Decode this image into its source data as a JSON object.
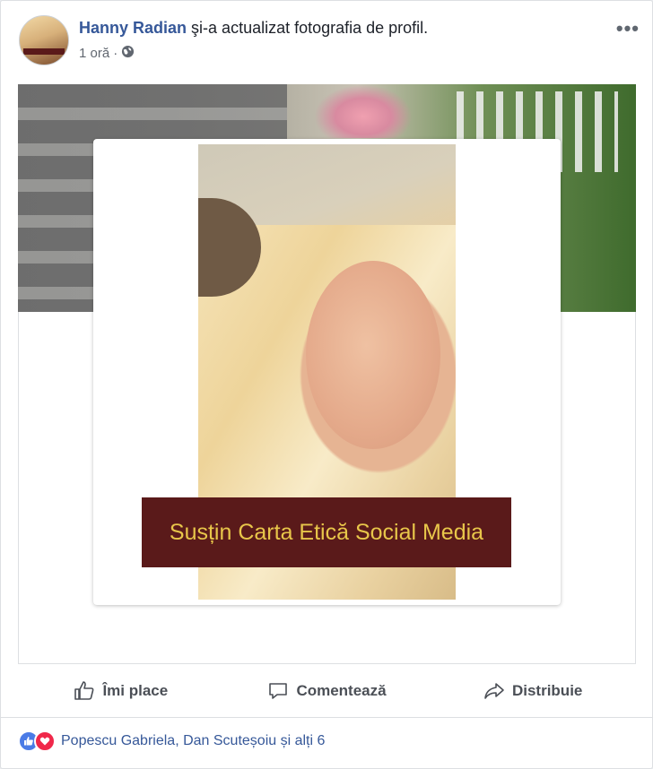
{
  "post": {
    "author": "Hanny Radian",
    "action_text": "şi-a actualizat fotografia de profil.",
    "time": "1 oră",
    "separator": "·",
    "privacy_icon": "globe-icon",
    "more_label": "•••"
  },
  "profile_photo": {
    "banner_text": "Susțin Carta Etică Social Media",
    "banner_colors": {
      "background": "#5a1a1a",
      "text": "#e8c64a"
    }
  },
  "actions": {
    "like_label": "Îmi place",
    "comment_label": "Comentează",
    "share_label": "Distribuie"
  },
  "reactions": {
    "text": "Popescu Gabriela, Dan Scuteșoiu și alți 6",
    "icons": [
      "like-reaction-icon",
      "love-reaction-icon"
    ]
  },
  "colors": {
    "link": "#365899",
    "secondary_text": "#616770",
    "like_blue": "#4a7be6",
    "love_red": "#f0284a"
  }
}
